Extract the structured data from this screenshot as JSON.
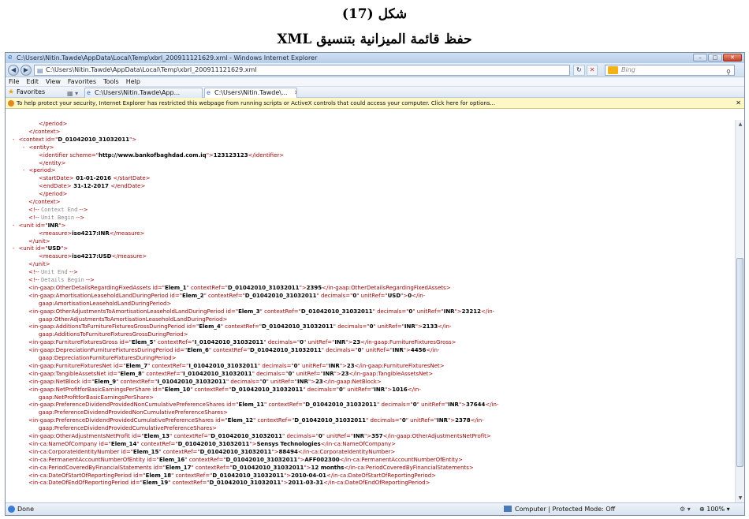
{
  "document": {
    "figure_number": "شكل (17)",
    "caption": "حفظ قائمة الميزانية بتنسيق XML"
  },
  "browser": {
    "title": "C:\\Users\\Nitin.Tawde\\AppData\\Local\\Temp\\xbrl_200911121629.xml - Windows Internet Explorer",
    "address": "C:\\Users\\Nitin.Tawde\\AppData\\Local\\Temp\\xbrl_200911121629.xml",
    "search_placeholder": "Bing",
    "menu": [
      "File",
      "Edit",
      "View",
      "Favorites",
      "Tools",
      "Help"
    ],
    "favorites_label": "Favorites",
    "tabs": [
      {
        "label": "C:\\Users\\Nitin.Tawde\\App..."
      },
      {
        "label": "C:\\Users\\Nitin.Tawde\\..."
      }
    ],
    "infobar": "To help protect your security, Internet Explorer has restricted this webpage from running scripts or ActiveX controls that could access your computer. Click here for options...",
    "status": {
      "text": "Done",
      "zone": "Computer | Protected Mode: Off",
      "zoom": "100%"
    }
  },
  "xml_lines": [
    [
      2,
      [
        "t",
        "</period>"
      ]
    ],
    [
      1,
      [
        "t",
        "</context>"
      ]
    ],
    [
      0,
      [
        "m",
        "- "
      ],
      [
        "t",
        "<context "
      ],
      [
        "a",
        "id=\""
      ],
      [
        "v",
        "D_01042010_31032011"
      ],
      [
        "a",
        "\">"
      ]
    ],
    [
      1,
      [
        "m",
        "- "
      ],
      [
        "t",
        "<entity>"
      ]
    ],
    [
      2,
      [
        "t",
        "<identifier "
      ],
      [
        "a",
        "scheme=\""
      ],
      [
        "v",
        "http://www.bankofbaghdad.com.iq"
      ],
      [
        "a",
        "\">"
      ],
      [
        "x",
        "123123123"
      ],
      [
        "t",
        "</identifier>"
      ]
    ],
    [
      2,
      [
        "t",
        "</entity>"
      ]
    ],
    [
      1,
      [
        "m",
        "- "
      ],
      [
        "t",
        "<period>"
      ]
    ],
    [
      2,
      [
        "t",
        "<startDate>"
      ],
      [
        "x",
        " 01-01-2016 "
      ],
      [
        "t",
        "</startDate>"
      ]
    ],
    [
      2,
      [
        "t",
        "<endDate>"
      ],
      [
        "x",
        "  31-12-2017 "
      ],
      [
        "t",
        "</endDate>"
      ]
    ],
    [
      2,
      [
        "t",
        "</period>"
      ]
    ],
    [
      1,
      [
        "t",
        "</context>"
      ]
    ],
    [
      1,
      [
        "t",
        "<!-- "
      ],
      [
        "c",
        "Context End"
      ],
      [
        "t",
        "  -->"
      ]
    ],
    [
      1,
      [
        "t",
        "<!-- "
      ],
      [
        "c",
        "Unit Begin"
      ],
      [
        "t",
        "  -->"
      ]
    ],
    [
      0,
      [
        "m",
        "- "
      ],
      [
        "t",
        "<unit "
      ],
      [
        "a",
        "id=\""
      ],
      [
        "v",
        "INR"
      ],
      [
        "a",
        "\">"
      ]
    ],
    [
      2,
      [
        "t",
        "<measure>"
      ],
      [
        "x",
        "iso4217:INR"
      ],
      [
        "t",
        "</measure>"
      ]
    ],
    [
      1,
      [
        "t",
        "</unit>"
      ]
    ],
    [
      0,
      [
        "m",
        "- "
      ],
      [
        "t",
        "<unit "
      ],
      [
        "a",
        "id=\""
      ],
      [
        "v",
        "USD"
      ],
      [
        "a",
        "\">"
      ]
    ],
    [
      2,
      [
        "t",
        "<measure>"
      ],
      [
        "x",
        "iso4217:USD"
      ],
      [
        "t",
        "</measure>"
      ]
    ],
    [
      1,
      [
        "t",
        "</unit>"
      ]
    ],
    [
      1,
      [
        "t",
        "<!-- "
      ],
      [
        "c",
        "Unit End"
      ],
      [
        "t",
        "  -->"
      ]
    ],
    [
      1,
      [
        "t",
        "<!-- "
      ],
      [
        "c",
        "Details Begin"
      ],
      [
        "t",
        "  -->"
      ]
    ],
    [
      1,
      [
        "t",
        "<in-gaap:OtherDetailsRegardingFixedAssets "
      ],
      [
        "a",
        "id=\""
      ],
      [
        "v",
        "Elem_1"
      ],
      [
        "a",
        "\" contextRef=\""
      ],
      [
        "v",
        "D_01042010_31032011"
      ],
      [
        "a",
        "\">"
      ],
      [
        "x",
        "2395"
      ],
      [
        "t",
        "</in-gaap:OtherDetailsRegardingFixedAssets>"
      ]
    ],
    [
      1,
      [
        "t",
        "<in-gaap:AmortisationLeaseholdLandDuringPeriod "
      ],
      [
        "a",
        "id=\""
      ],
      [
        "v",
        "Elem_2"
      ],
      [
        "a",
        "\" contextRef=\""
      ],
      [
        "v",
        "D_01042010_31032011"
      ],
      [
        "a",
        "\" decimals=\""
      ],
      [
        "v",
        "0"
      ],
      [
        "a",
        "\" unitRef=\""
      ],
      [
        "v",
        "USD"
      ],
      [
        "a",
        "\">"
      ],
      [
        "x",
        "0"
      ],
      [
        "t",
        "</in-"
      ]
    ],
    [
      2,
      [
        "t",
        "gaap:AmortisationLeaseholdLandDuringPeriod>"
      ]
    ],
    [
      1,
      [
        "t",
        "<in-gaap:OtherAdjustmentsToAmortisationLeaseholdLandDuringPeriod "
      ],
      [
        "a",
        "id=\""
      ],
      [
        "v",
        "Elem_3"
      ],
      [
        "a",
        "\" contextRef=\""
      ],
      [
        "v",
        "D_01042010_31032011"
      ],
      [
        "a",
        "\" decimals=\""
      ],
      [
        "v",
        "0"
      ],
      [
        "a",
        "\" unitRef=\""
      ],
      [
        "v",
        "INR"
      ],
      [
        "a",
        "\">"
      ],
      [
        "x",
        "23212"
      ],
      [
        "t",
        "</in-"
      ]
    ],
    [
      2,
      [
        "t",
        "gaap:OtherAdjustmentsToAmortisationLeaseholdLandDuringPeriod>"
      ]
    ],
    [
      1,
      [
        "t",
        "<in-gaap:AdditionsToFurnitureFixturesGrossDuringPeriod "
      ],
      [
        "a",
        "id=\""
      ],
      [
        "v",
        "Elem_4"
      ],
      [
        "a",
        "\" contextRef=\""
      ],
      [
        "v",
        "D_01042010_31032011"
      ],
      [
        "a",
        "\" decimals=\""
      ],
      [
        "v",
        "0"
      ],
      [
        "a",
        "\" unitRef=\""
      ],
      [
        "v",
        "INR"
      ],
      [
        "a",
        "\">"
      ],
      [
        "x",
        "2133"
      ],
      [
        "t",
        "</in-"
      ]
    ],
    [
      2,
      [
        "t",
        "gaap:AdditionsToFurnitureFixturesGrossDuringPeriod>"
      ]
    ],
    [
      1,
      [
        "t",
        "<in-gaap:FurnitureFixturesGross "
      ],
      [
        "a",
        "id=\""
      ],
      [
        "v",
        "Elem_5"
      ],
      [
        "a",
        "\" contextRef=\""
      ],
      [
        "v",
        "I_01042010_31032011"
      ],
      [
        "a",
        "\" decimals=\""
      ],
      [
        "v",
        "0"
      ],
      [
        "a",
        "\" unitRef=\""
      ],
      [
        "v",
        "INR"
      ],
      [
        "a",
        "\">"
      ],
      [
        "x",
        "23"
      ],
      [
        "t",
        "</in-gaap:FurnitureFixturesGross>"
      ]
    ],
    [
      1,
      [
        "t",
        "<in-gaap:DepreciationFurnitureFixturesDuringPeriod "
      ],
      [
        "a",
        "id=\""
      ],
      [
        "v",
        "Elem_6"
      ],
      [
        "a",
        "\" contextRef=\""
      ],
      [
        "v",
        "D_01042010_31032011"
      ],
      [
        "a",
        "\" decimals=\""
      ],
      [
        "v",
        "0"
      ],
      [
        "a",
        "\" unitRef=\""
      ],
      [
        "v",
        "INR"
      ],
      [
        "a",
        "\">"
      ],
      [
        "x",
        "4456"
      ],
      [
        "t",
        "</in-"
      ]
    ],
    [
      2,
      [
        "t",
        "gaap:DepreciationFurnitureFixturesDuringPeriod>"
      ]
    ],
    [
      1,
      [
        "t",
        "<in-gaap:FurnitureFixturesNet "
      ],
      [
        "a",
        "id=\""
      ],
      [
        "v",
        "Elem_7"
      ],
      [
        "a",
        "\" contextRef=\""
      ],
      [
        "v",
        "I_01042010_31032011"
      ],
      [
        "a",
        "\" decimals=\""
      ],
      [
        "v",
        "0"
      ],
      [
        "a",
        "\" unitRef=\""
      ],
      [
        "v",
        "INR"
      ],
      [
        "a",
        "\">"
      ],
      [
        "x",
        "23"
      ],
      [
        "t",
        "</in-gaap:FurnitureFixturesNet>"
      ]
    ],
    [
      1,
      [
        "t",
        "<in-gaap:TangibleAssetsNet "
      ],
      [
        "a",
        "id=\""
      ],
      [
        "v",
        "Elem_8"
      ],
      [
        "a",
        "\" contextRef=\""
      ],
      [
        "v",
        "I_01042010_31032011"
      ],
      [
        "a",
        "\" decimals=\""
      ],
      [
        "v",
        "0"
      ],
      [
        "a",
        "\" unitRef=\""
      ],
      [
        "v",
        "INR"
      ],
      [
        "a",
        "\">"
      ],
      [
        "x",
        "23"
      ],
      [
        "t",
        "</in-gaap:TangibleAssetsNet>"
      ]
    ],
    [
      1,
      [
        "t",
        "<in-gaap:NetBlock "
      ],
      [
        "a",
        "id=\""
      ],
      [
        "v",
        "Elem_9"
      ],
      [
        "a",
        "\" contextRef=\""
      ],
      [
        "v",
        "I_01042010_31032011"
      ],
      [
        "a",
        "\" decimals=\""
      ],
      [
        "v",
        "0"
      ],
      [
        "a",
        "\" unitRef=\""
      ],
      [
        "v",
        "INR"
      ],
      [
        "a",
        "\">"
      ],
      [
        "x",
        "23"
      ],
      [
        "t",
        "</in-gaap:NetBlock>"
      ]
    ],
    [
      1,
      [
        "t",
        "<in-gaap:NetProfitforBasicEarningsPerShare "
      ],
      [
        "a",
        "id=\""
      ],
      [
        "v",
        "Elem_10"
      ],
      [
        "a",
        "\" contextRef=\""
      ],
      [
        "v",
        "D_01042010_31032011"
      ],
      [
        "a",
        "\" decimals=\""
      ],
      [
        "v",
        "0"
      ],
      [
        "a",
        "\" unitRef=\""
      ],
      [
        "v",
        "INR"
      ],
      [
        "a",
        "\">"
      ],
      [
        "x",
        "1016"
      ],
      [
        "t",
        "</in-"
      ]
    ],
    [
      2,
      [
        "t",
        "gaap:NetProfitforBasicEarningsPerShare>"
      ]
    ],
    [
      1,
      [
        "t",
        "<in-gaap:PreferenceDividendProvidedNonCumulativePreferenceShares "
      ],
      [
        "a",
        "id=\""
      ],
      [
        "v",
        "Elem_11"
      ],
      [
        "a",
        "\" contextRef=\""
      ],
      [
        "v",
        "D_01042010_31032011"
      ],
      [
        "a",
        "\" decimals=\""
      ],
      [
        "v",
        "0"
      ],
      [
        "a",
        "\" unitRef=\""
      ],
      [
        "v",
        "INR"
      ],
      [
        "a",
        "\">"
      ],
      [
        "x",
        "37644"
      ],
      [
        "t",
        "</in-"
      ]
    ],
    [
      2,
      [
        "t",
        "gaap:PreferenceDividendProvidedNonCumulativePreferenceShares>"
      ]
    ],
    [
      1,
      [
        "t",
        "<in-gaap:PreferenceDividendProvidedCumulativePreferenceShares "
      ],
      [
        "a",
        "id=\""
      ],
      [
        "v",
        "Elem_12"
      ],
      [
        "a",
        "\" contextRef=\""
      ],
      [
        "v",
        "D_01042010_31032011"
      ],
      [
        "a",
        "\" decimals=\""
      ],
      [
        "v",
        "0"
      ],
      [
        "a",
        "\" unitRef=\""
      ],
      [
        "v",
        "INR"
      ],
      [
        "a",
        "\">"
      ],
      [
        "x",
        "2378"
      ],
      [
        "t",
        "</in-"
      ]
    ],
    [
      2,
      [
        "t",
        "gaap:PreferenceDividendProvidedCumulativePreferenceShares>"
      ]
    ],
    [
      1,
      [
        "t",
        "<in-gaap:OtherAdjustmentsNetProfit "
      ],
      [
        "a",
        "id=\""
      ],
      [
        "v",
        "Elem_13"
      ],
      [
        "a",
        "\" contextRef=\""
      ],
      [
        "v",
        "D_01042010_31032011"
      ],
      [
        "a",
        "\" decimals=\""
      ],
      [
        "v",
        "0"
      ],
      [
        "a",
        "\" unitRef=\""
      ],
      [
        "v",
        "INR"
      ],
      [
        "a",
        "\">"
      ],
      [
        "x",
        "357"
      ],
      [
        "t",
        "</in-gaap:OtherAdjustmentsNetProfit>"
      ]
    ],
    [
      1,
      [
        "t",
        "<in-ca:NameOfCompany "
      ],
      [
        "a",
        "id=\""
      ],
      [
        "v",
        "Elem_14"
      ],
      [
        "a",
        "\" contextRef=\""
      ],
      [
        "v",
        "D_01042010_31032011"
      ],
      [
        "a",
        "\">"
      ],
      [
        "x",
        "Sensys Technologies"
      ],
      [
        "t",
        "</in-ca:NameOfCompany>"
      ]
    ],
    [
      1,
      [
        "t",
        "<in-ca:CorporateIdentityNumber "
      ],
      [
        "a",
        "id=\""
      ],
      [
        "v",
        "Elem_15"
      ],
      [
        "a",
        "\" contextRef=\""
      ],
      [
        "v",
        "D_01042010_31032011"
      ],
      [
        "a",
        "\">"
      ],
      [
        "x",
        "88494"
      ],
      [
        "t",
        "</in-ca:CorporateIdentityNumber>"
      ]
    ],
    [
      1,
      [
        "t",
        "<in-ca:PermanentAccountNumberOfEntity "
      ],
      [
        "a",
        "id=\""
      ],
      [
        "v",
        "Elem_16"
      ],
      [
        "a",
        "\" contextRef=\""
      ],
      [
        "v",
        "D_01042010_31032011"
      ],
      [
        "a",
        "\">"
      ],
      [
        "x",
        "AFF002300"
      ],
      [
        "t",
        "</in-ca:PermanentAccountNumberOfEntity>"
      ]
    ],
    [
      1,
      [
        "t",
        "<in-ca:PeriodCoveredByFinancialStatements "
      ],
      [
        "a",
        "id=\""
      ],
      [
        "v",
        "Elem_17"
      ],
      [
        "a",
        "\" contextRef=\""
      ],
      [
        "v",
        "D_01042010_31032011"
      ],
      [
        "a",
        "\">"
      ],
      [
        "x",
        "12 months"
      ],
      [
        "t",
        "</in-ca:PeriodCoveredByFinancialStatements>"
      ]
    ],
    [
      1,
      [
        "t",
        "<in-ca:DateOfStartOfReportingPeriod "
      ],
      [
        "a",
        "id=\""
      ],
      [
        "v",
        "Elem_18"
      ],
      [
        "a",
        "\" contextRef=\""
      ],
      [
        "v",
        "D_01042010_31032011"
      ],
      [
        "a",
        "\">"
      ],
      [
        "x",
        "2010-04-01"
      ],
      [
        "t",
        "</in-ca:DateOfStartOfReportingPeriod>"
      ]
    ],
    [
      1,
      [
        "t",
        "<in-ca:DateOfEndOfReportingPeriod "
      ],
      [
        "a",
        "id=\""
      ],
      [
        "v",
        "Elem_19"
      ],
      [
        "a",
        "\" contextRef=\""
      ],
      [
        "v",
        "D_01042010_31032011"
      ],
      [
        "a",
        "\">"
      ],
      [
        "x",
        "2011-03-31"
      ],
      [
        "t",
        "</in-ca:DateOfEndOfReportingPeriod>"
      ]
    ]
  ]
}
